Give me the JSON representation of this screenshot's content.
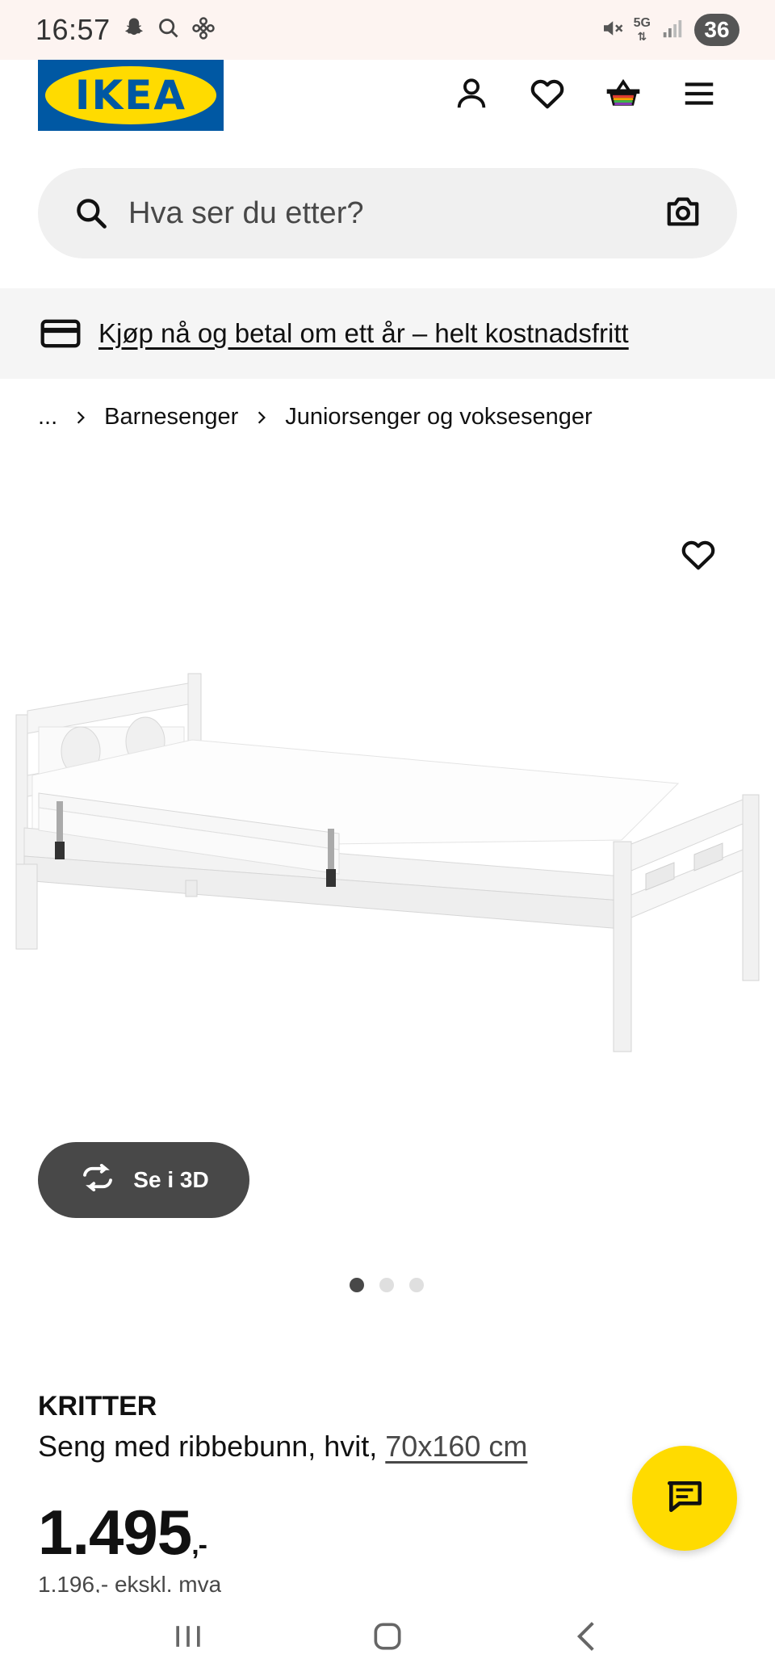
{
  "status_bar": {
    "time": "16:57",
    "network": "5G",
    "battery": "36"
  },
  "header": {
    "logo_text": "IKEA",
    "icons": [
      "person-icon",
      "heart-icon",
      "basket-icon",
      "menu-icon"
    ]
  },
  "search": {
    "placeholder": "Hva ser du etter?",
    "icons": [
      "search-icon",
      "camera-icon"
    ]
  },
  "promo": {
    "text": "Kjøp nå og betal om ett år – helt kostnadsfritt",
    "icon": "credit-card-icon"
  },
  "breadcrumb": {
    "items": [
      "...",
      "Barnesenger",
      "Juniorsenger og voksesenger"
    ]
  },
  "gallery": {
    "button_3d_label": "Se i 3D",
    "slide_count": 3,
    "active_slide": 1
  },
  "product": {
    "name": "KRITTER",
    "description": "Seng med ribbebunn, hvit, ",
    "size": "70x160 cm",
    "price": "1.495",
    "price_suffix": ",-",
    "price_ex_vat": "1.196,- ekskl. mva"
  },
  "colors": {
    "ikea_blue": "#0058a3",
    "ikea_yellow": "#ffdb00",
    "dark_gray": "#484848"
  }
}
